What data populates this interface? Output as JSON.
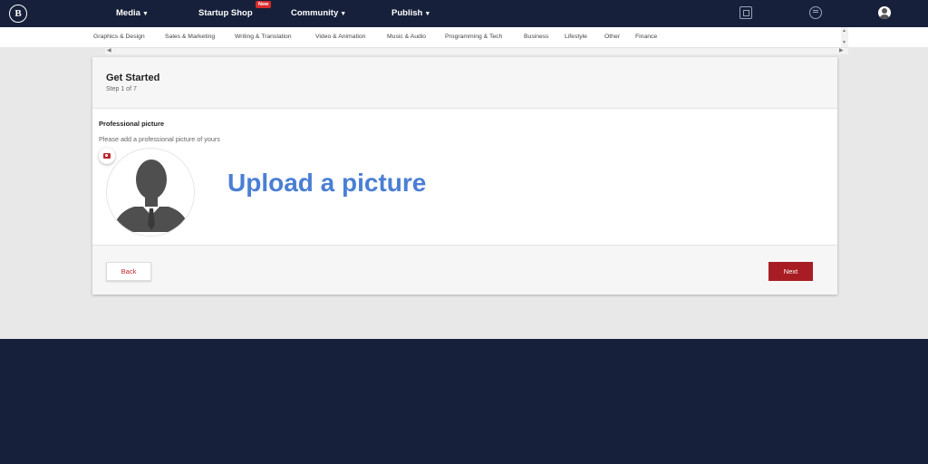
{
  "nav": {
    "logo": "B",
    "items": [
      {
        "label": "Media",
        "caret": "▼"
      },
      {
        "label": "Startup Shop",
        "badge": "New"
      },
      {
        "label": "Community",
        "caret": "▼"
      },
      {
        "label": "Publish",
        "caret": "▼"
      }
    ],
    "icons": [
      "grid-icon",
      "chat-icon",
      "user-avatar-icon"
    ]
  },
  "categories": [
    "Graphics & Design",
    "Sales & Marketing",
    "Writing & Translation",
    "Video & Animation",
    "Music & Audio",
    "Programming & Tech",
    "Business",
    "Lifestyle",
    "Other",
    "Finance"
  ],
  "card": {
    "title": "Get Started",
    "step": "Step 1 of 7",
    "field_label": "Professional picture",
    "field_help": "Please add a professional picture of yours",
    "upload_text": "Upload a picture",
    "back_label": "Back",
    "next_label": "Next"
  },
  "colors": {
    "navy": "#16203a",
    "accent_red": "#a81d23",
    "upload_blue": "#4a7fd4"
  }
}
